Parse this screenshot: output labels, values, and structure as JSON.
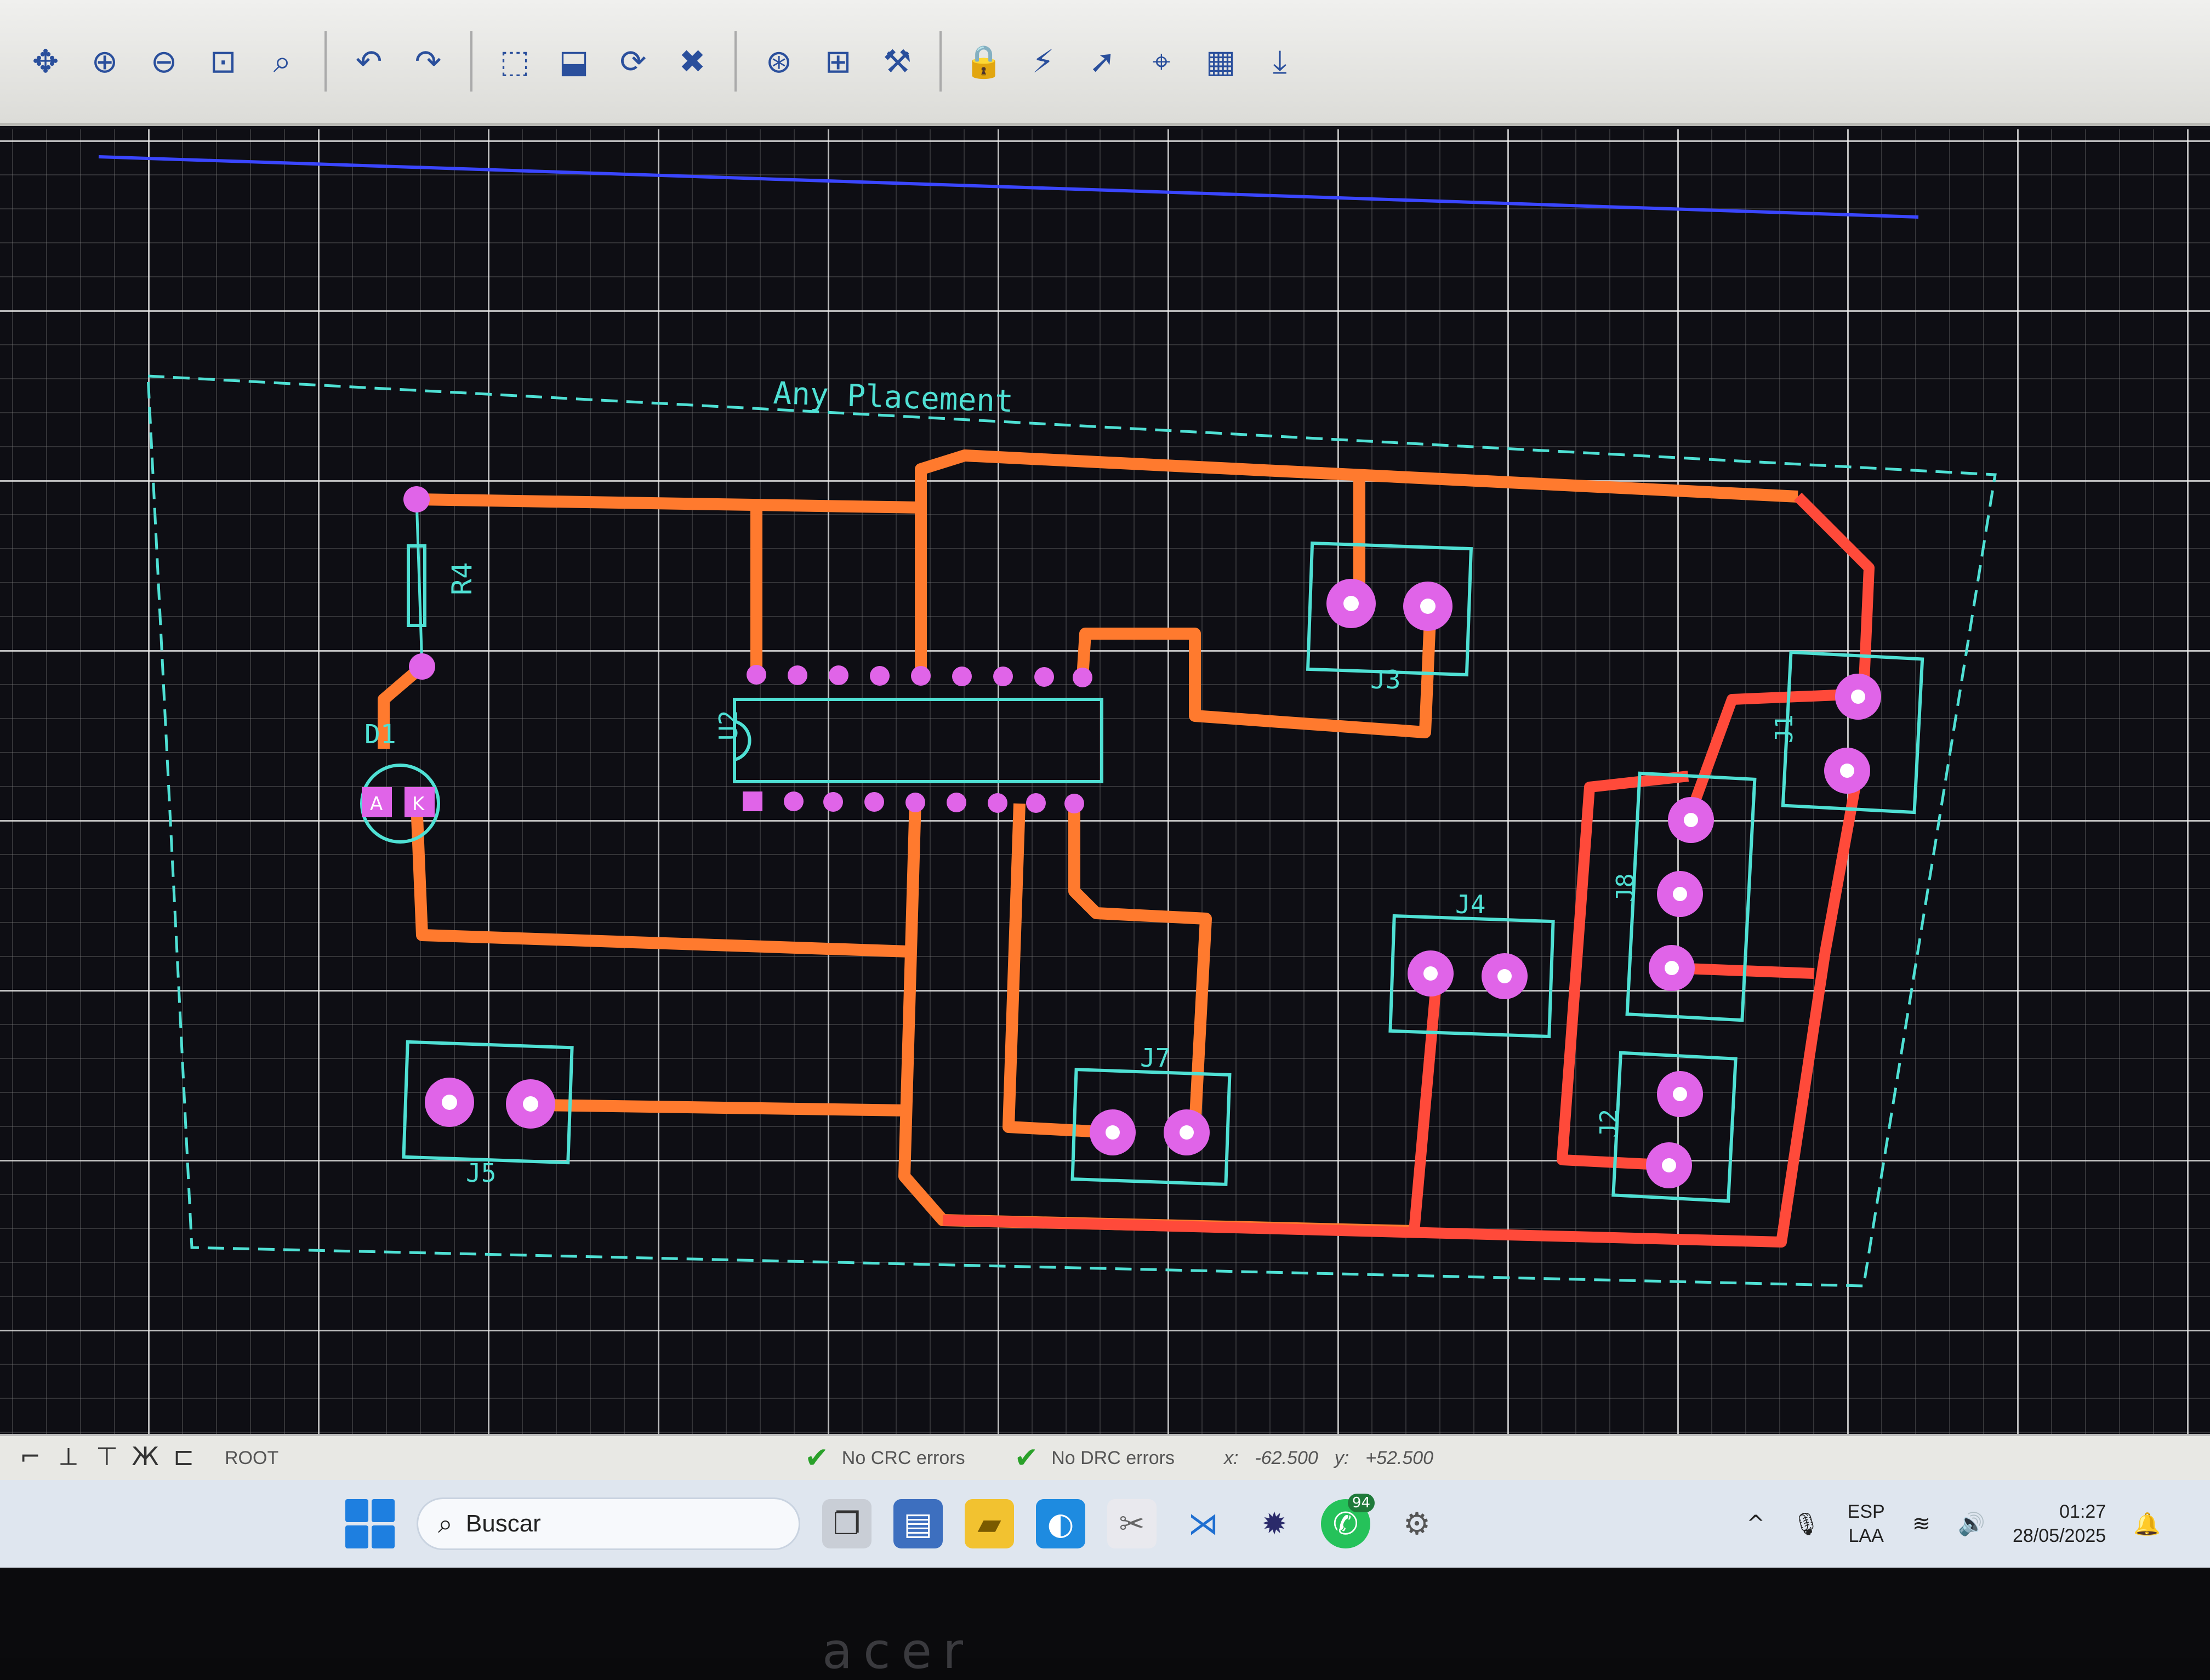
{
  "toolbar": {
    "icons": [
      "pan-icon",
      "zoom-in-icon",
      "zoom-out-icon",
      "zoom-fit-icon",
      "zoom-area-icon",
      "undo-icon",
      "redo-icon",
      "block-copy-icon",
      "block-move-icon",
      "block-rotate-icon",
      "block-delete-icon",
      "pick-part-icon",
      "make-device-icon",
      "package-tool-icon",
      "design-rule-icon",
      "autorouter-icon",
      "search-tag-icon",
      "property-assign-icon",
      "3d-view-icon",
      "export-gerber-icon"
    ],
    "glyphs": [
      "✥",
      "⊕",
      "⊖",
      "⊡",
      "⌕",
      "↶",
      "↷",
      "⬚",
      "⬓",
      "⟳",
      "✖",
      "⊛",
      "⊞",
      "⚒",
      "🔒",
      "⚡",
      "➚",
      "⌖",
      "▦",
      "⤓"
    ]
  },
  "board": {
    "placement_label": "Any Placement",
    "components": {
      "r4": "R4",
      "d1": "D1",
      "d1_anode": "A",
      "d1_cathode": "K",
      "u2": "U2",
      "j1": "J1",
      "j2": "J2",
      "j3": "J3",
      "j4": "J4",
      "j5": "J5",
      "j7": "J7",
      "j8": "J8"
    },
    "colors": {
      "trace_orange": "#ff7a2e",
      "trace_red": "#ff4a3a",
      "pad": "#e064e8",
      "silkscreen": "#4fe0d4"
    }
  },
  "statusbar": {
    "root_label": "ROOT",
    "crc_status": "No CRC errors",
    "drc_status": "No DRC errors",
    "x_label": "x:",
    "x_value": "-62.500",
    "y_label": "y:",
    "y_value": "+52.500"
  },
  "taskbar": {
    "search_placeholder": "Buscar",
    "whatsapp_badge": "94",
    "lang_line1": "ESP",
    "lang_line2": "LAA",
    "time": "01:27",
    "date": "28/05/2025"
  }
}
